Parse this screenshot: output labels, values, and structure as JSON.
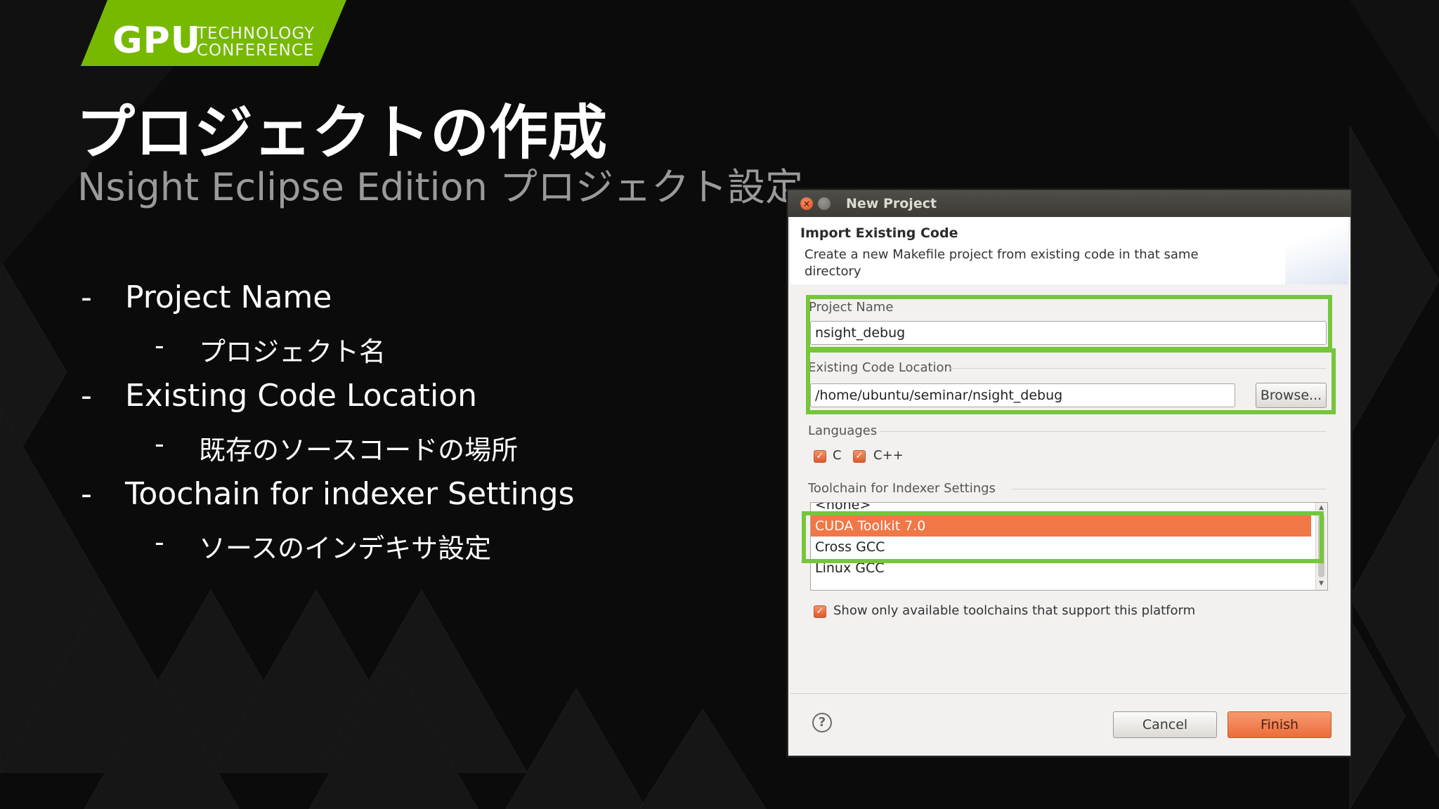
{
  "slide": {
    "logo": {
      "main": "GPU",
      "line1": "TECHNOLOGY",
      "line2": "CONFERENCE"
    },
    "title": "プロジェクトの作成",
    "subtitle": "Nsight Eclipse Edition プロジェクト設定",
    "bullets": [
      {
        "level": 1,
        "dash": "-",
        "text": "Project Name"
      },
      {
        "level": 2,
        "dash": "-",
        "text": "プロジェクト名"
      },
      {
        "level": 1,
        "dash": "-",
        "text": "Existing Code Location"
      },
      {
        "level": 2,
        "dash": "-",
        "text": "既存のソースコードの場所"
      },
      {
        "level": 1,
        "dash": "-",
        "text": "Toochain for indexer Settings"
      },
      {
        "level": 2,
        "dash": "-",
        "text": "ソースのインデキサ設定"
      }
    ],
    "colors": {
      "accent_green": "#76c63a",
      "background": "#0b0b0b"
    }
  },
  "dialog": {
    "title": "New Project",
    "close_icon": "×",
    "header": {
      "title": "Import Existing Code",
      "description": "Create a new Makefile project from existing code in that same directory"
    },
    "project_name": {
      "label": "Project Name",
      "value": "nsight_debug"
    },
    "location": {
      "label": "Existing Code Location",
      "value": "/home/ubuntu/seminar/nsight_debug",
      "browse_label": "Browse..."
    },
    "languages": {
      "label": "Languages",
      "items": [
        {
          "label": "C",
          "checked": true
        },
        {
          "label": "C++",
          "checked": true
        }
      ]
    },
    "toolchain": {
      "label": "Toolchain for Indexer Settings",
      "items": [
        "<none>",
        "CUDA Toolkit 7.0",
        "Cross GCC",
        "Linux GCC"
      ],
      "selected": "CUDA Toolkit 7.0",
      "show_only_label": "Show only available toolchains that support this platform",
      "show_only_checked": true
    },
    "help_symbol": "?",
    "buttons": {
      "cancel": "Cancel",
      "finish": "Finish"
    },
    "colors": {
      "selection": "#f07746",
      "primary_button": "#f07746",
      "highlight_frame": "#76c63a"
    }
  }
}
